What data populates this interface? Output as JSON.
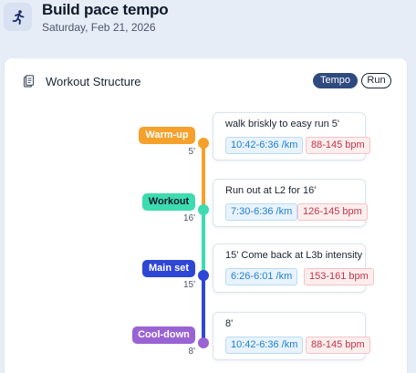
{
  "header": {
    "title": "Build pace tempo",
    "date": "Saturday, Feb 21, 2026",
    "icon": "runner-icon"
  },
  "card": {
    "title": "Workout Structure",
    "icon": "clipboard-icon",
    "tags": [
      "Tempo",
      "Run"
    ]
  },
  "steps": [
    {
      "phase": "Warm-up",
      "duration": "5'",
      "color": "#f5a12b",
      "text_color": "#ffffff",
      "description": "walk briskly to easy run 5'",
      "pace": "10:42-6:36 /km",
      "heart_rate": "88-145 bpm"
    },
    {
      "phase": "Workout",
      "duration": "16'",
      "color": "#3ddbb0",
      "text_color": "#0f1a2b",
      "description": "Run out at L2 for 16'",
      "pace": "7:30-6:36 /km",
      "heart_rate": "126-145 bpm"
    },
    {
      "phase": "Main set",
      "duration": "15'",
      "color": "#2e46d6",
      "text_color": "#ffffff",
      "description": "15' Come back at L3b intensity",
      "pace": "6:26-6:01 /km",
      "heart_rate": "153-161 bpm"
    },
    {
      "phase": "Cool-down",
      "duration": "8'",
      "color": "#9a63d4",
      "text_color": "#ffffff",
      "description": "8'",
      "pace": "10:42-6:36 /km",
      "heart_rate": "88-145 bpm"
    }
  ]
}
